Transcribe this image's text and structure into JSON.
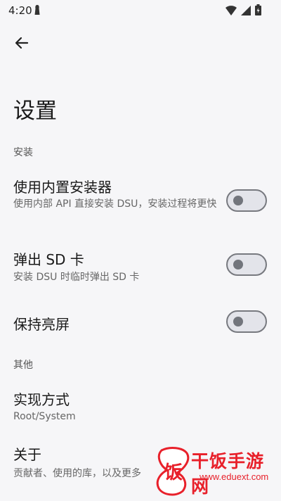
{
  "status_bar": {
    "time": "4:20"
  },
  "header": {
    "title": "设置"
  },
  "sections": [
    {
      "header": "安装",
      "items": [
        {
          "title": "使用内置安装器",
          "subtitle": "使用内部 API 直接安装 DSU，安装过程将更快",
          "toggle": false
        },
        {
          "title": "弹出 SD 卡",
          "subtitle": "安装 DSU 时临时弹出 SD 卡",
          "toggle": false
        },
        {
          "title": "保持亮屏",
          "toggle": false
        }
      ]
    },
    {
      "header": "其他",
      "items": [
        {
          "title": "实现方式",
          "subtitle": "Root/System"
        },
        {
          "title": "关于",
          "subtitle": "贡献者、使用的库，以及更多"
        }
      ]
    }
  ],
  "watermark": {
    "brand": "干饭手游网",
    "url": "www.eduext.com",
    "logo_char": "饭"
  },
  "colors": {
    "background": "#f6f6f8",
    "toggle_track": "#e3e4ea",
    "toggle_border": "#77797f",
    "watermark": "#e8202a"
  }
}
